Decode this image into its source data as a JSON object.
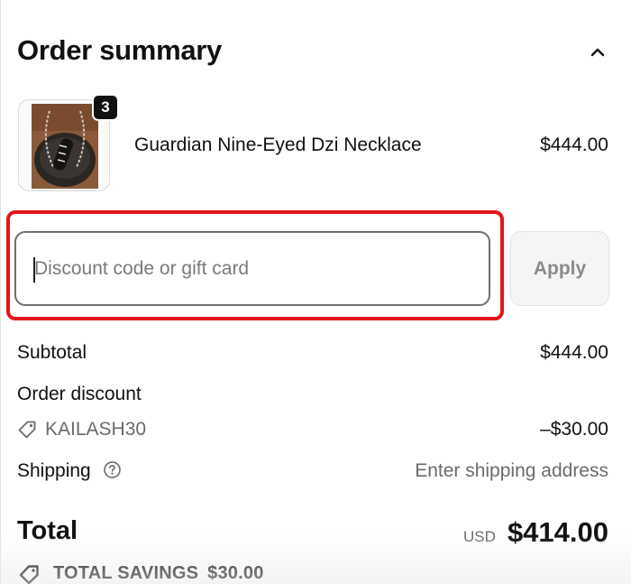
{
  "order_summary": {
    "title": "Order summary",
    "collapse_icon": "chevron-up-icon"
  },
  "line_item": {
    "quantity": "3",
    "name": "Guardian Nine-Eyed Dzi Necklace",
    "price": "$444.00"
  },
  "discount": {
    "placeholder": "Discount code or gift card",
    "value": "",
    "apply_label": "Apply",
    "highlight_color": "#e3151a"
  },
  "summary": {
    "subtotal_label": "Subtotal",
    "subtotal_value": "$444.00",
    "order_discount_label": "Order discount",
    "discount_code": "KAILASH30",
    "discount_value": "–$30.00",
    "shipping_label": "Shipping",
    "shipping_value": "Enter shipping address"
  },
  "total": {
    "label": "Total",
    "currency": "USD",
    "amount": "$414.00"
  },
  "savings": {
    "label": "TOTAL SAVINGS",
    "amount": "$30.00"
  }
}
